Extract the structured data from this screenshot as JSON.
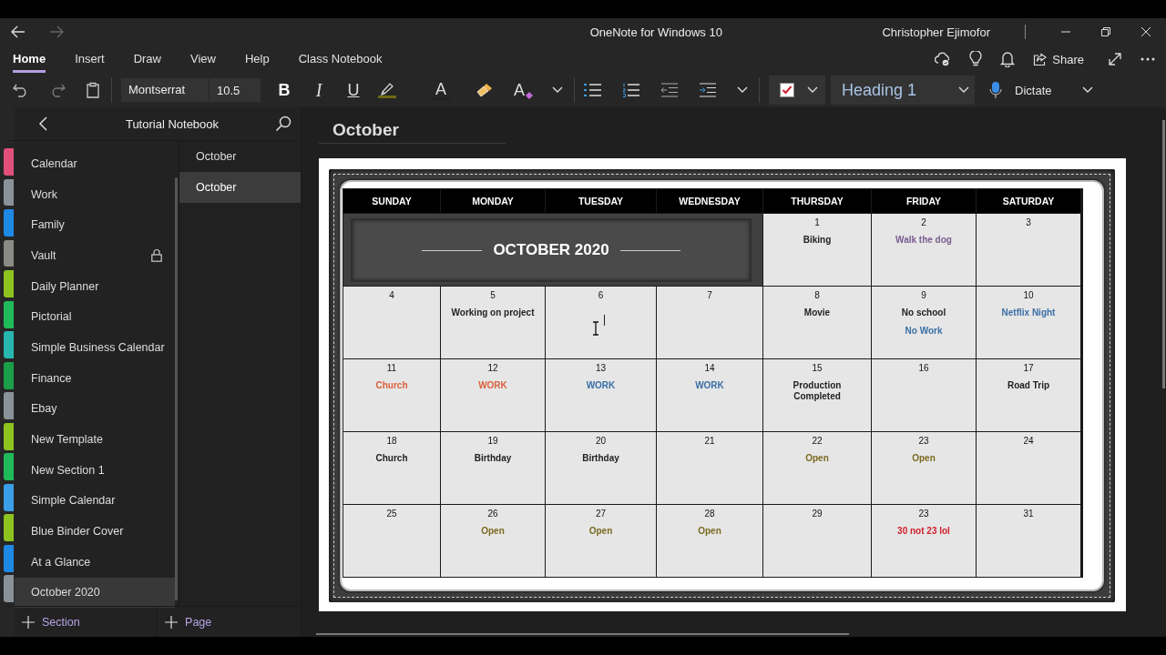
{
  "window": {
    "title": "OneNote for Windows 10",
    "user": "Christopher Ejimofor"
  },
  "ribbon_tabs": [
    {
      "label": "Home",
      "selected": true
    },
    {
      "label": "Insert",
      "selected": false
    },
    {
      "label": "Draw",
      "selected": false
    },
    {
      "label": "View",
      "selected": false
    },
    {
      "label": "Help",
      "selected": false
    },
    {
      "label": "Class Notebook",
      "selected": false
    }
  ],
  "share": "Share",
  "toolbar": {
    "font": "Montserrat",
    "size": "10.5",
    "bold": "B",
    "italic": "I",
    "underline": "U",
    "font_color": "A",
    "clear_format": "A",
    "style": "Heading 1",
    "dictate": "Dictate"
  },
  "notebook": {
    "title": "Tutorial Notebook",
    "add_section": "Section",
    "add_page": "Page"
  },
  "sections": [
    {
      "label": "Calendar",
      "color": "#e0507a",
      "selected": false,
      "locked": false
    },
    {
      "label": "Work",
      "color": "#8a9299",
      "selected": false,
      "locked": false
    },
    {
      "label": "Family",
      "color": "#1e88e5",
      "selected": false,
      "locked": false
    },
    {
      "label": "Vault",
      "color": "#8a8a86",
      "selected": false,
      "locked": true
    },
    {
      "label": "Daily Planner",
      "color": "#8dc21f",
      "selected": false,
      "locked": false
    },
    {
      "label": "Pictorial",
      "color": "#1fba5a",
      "selected": false,
      "locked": false
    },
    {
      "label": "Simple Business Calendar",
      "color": "#27b7b0",
      "selected": false,
      "locked": false
    },
    {
      "label": "Finance",
      "color": "#1a9e48",
      "selected": false,
      "locked": false
    },
    {
      "label": "Ebay",
      "color": "#8a9299",
      "selected": false,
      "locked": false
    },
    {
      "label": "New Template",
      "color": "#8dc21f",
      "selected": false,
      "locked": false
    },
    {
      "label": "New Section 1",
      "color": "#1fba5a",
      "selected": false,
      "locked": false
    },
    {
      "label": "Simple Calendar",
      "color": "#3a9ee8",
      "selected": false,
      "locked": false
    },
    {
      "label": "Blue Binder Cover",
      "color": "#8dc21f",
      "selected": false,
      "locked": false
    },
    {
      "label": "At a Glance",
      "color": "#1e88e5",
      "selected": false,
      "locked": false
    },
    {
      "label": "October 2020",
      "color": "#8a9299",
      "selected": true,
      "locked": false
    }
  ],
  "pages": [
    {
      "label": "October",
      "selected": false
    },
    {
      "label": "October",
      "selected": true
    }
  ],
  "page_title": "October",
  "calendar": {
    "banner": "OCTOBER 2020",
    "weekdays": [
      "SUNDAY",
      "MONDAY",
      "TUESDAY",
      "WEDNESDAY",
      "THURSDAY",
      "FRIDAY",
      "SATURDAY"
    ],
    "days": [
      {
        "day": "1",
        "events": [
          {
            "text": "Biking",
            "color": "#222222"
          }
        ]
      },
      {
        "day": "2",
        "events": [
          {
            "text": "Walk the dog",
            "color": "#7a5c8f"
          }
        ]
      },
      {
        "day": "3"
      },
      {
        "day": "4"
      },
      {
        "day": "5",
        "events": [
          {
            "text": "Working on project",
            "color": "#222222"
          }
        ]
      },
      {
        "day": "6"
      },
      {
        "day": "7"
      },
      {
        "day": "8",
        "events": [
          {
            "text": "Movie",
            "color": "#222222"
          }
        ]
      },
      {
        "day": "9",
        "events": [
          {
            "text": "No school",
            "color": "#222222"
          },
          {
            "text": "No Work",
            "color": "#3a6ea5"
          }
        ]
      },
      {
        "day": "10",
        "events": [
          {
            "text": "Netflix Night",
            "color": "#3a6ea5"
          }
        ]
      },
      {
        "day": "11",
        "events": [
          {
            "text": "Church",
            "color": "#d9603b"
          }
        ]
      },
      {
        "day": "12",
        "events": [
          {
            "text": "WORK",
            "color": "#d9603b"
          }
        ]
      },
      {
        "day": "13",
        "events": [
          {
            "text": "WORK",
            "color": "#3a6ea5"
          }
        ]
      },
      {
        "day": "14",
        "events": [
          {
            "text": "WORK",
            "color": "#3a6ea5"
          }
        ]
      },
      {
        "day": "15",
        "events": [
          {
            "text": "Production Completed",
            "color": "#222222"
          }
        ]
      },
      {
        "day": "16"
      },
      {
        "day": "17",
        "events": [
          {
            "text": "Road Trip",
            "color": "#222222"
          }
        ]
      },
      {
        "day": "18",
        "events": [
          {
            "text": "Church",
            "color": "#222222"
          }
        ]
      },
      {
        "day": "19",
        "events": [
          {
            "text": "Birthday",
            "color": "#222222"
          }
        ]
      },
      {
        "day": "20",
        "events": [
          {
            "text": "Birthday",
            "color": "#222222"
          }
        ]
      },
      {
        "day": "21"
      },
      {
        "day": "22",
        "events": [
          {
            "text": "Open",
            "color": "#7a6a1f"
          }
        ]
      },
      {
        "day": "23",
        "events": [
          {
            "text": "Open",
            "color": "#7a6a1f"
          }
        ]
      },
      {
        "day": "24"
      },
      {
        "day": "25"
      },
      {
        "day": "26",
        "events": [
          {
            "text": "Open",
            "color": "#7a6a1f"
          }
        ]
      },
      {
        "day": "27",
        "events": [
          {
            "text": "Open",
            "color": "#7a6a1f"
          }
        ]
      },
      {
        "day": "28",
        "events": [
          {
            "text": "Open",
            "color": "#7a6a1f"
          }
        ]
      },
      {
        "day": "29"
      },
      {
        "day": "23",
        "events": [
          {
            "text": "30 not 23 lol",
            "color": "#d0202a"
          }
        ]
      },
      {
        "day": "31"
      }
    ]
  }
}
